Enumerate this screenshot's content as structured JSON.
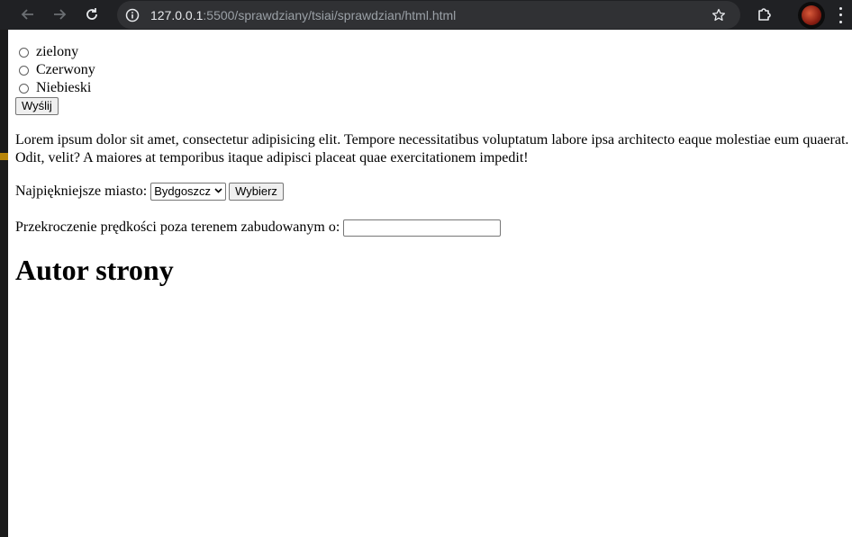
{
  "browser": {
    "url_host": "127.0.0.1",
    "url_rest": ":5500/sprawdziany/tsiai/sprawdzian/html.html",
    "icons": [
      "back-arrow-icon",
      "forward-arrow-icon",
      "reload-icon",
      "info-icon",
      "star-icon",
      "extensions-icon",
      "profile-avatar",
      "menu-icon"
    ]
  },
  "form": {
    "radios": [
      {
        "label": "zielony"
      },
      {
        "label": "Czerwony"
      },
      {
        "label": "Niebieski"
      }
    ],
    "submit_label": "Wyślij"
  },
  "paragraph": "Lorem ipsum dolor sit amet, consectetur adipisicing elit. Tempore necessitatibus voluptatum labore ipsa architecto eaque molestiae eum quaerat. Odit, velit? A maiores at temporibus itaque adipisci placeat quae exercitationem impedit!",
  "city": {
    "label": "Najpiękniejsze miasto:",
    "selected": "Bydgoszcz",
    "button": "Wybierz"
  },
  "speed": {
    "label": "Przekroczenie prędkości poza terenem zabudowanym o:",
    "value": ""
  },
  "heading": "Autor strony",
  "colors": {
    "toolbar": "#202124",
    "urlbar": "#303134"
  }
}
